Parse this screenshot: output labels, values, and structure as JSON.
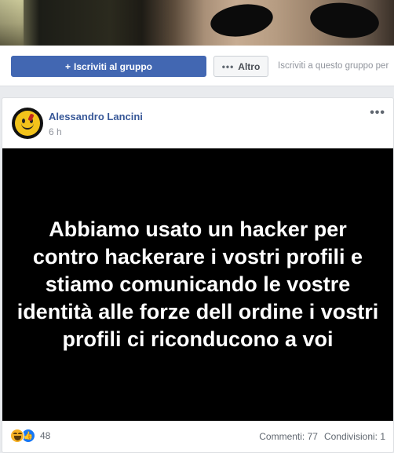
{
  "group_header": {
    "join_button_label": "Iscriviti al gruppo",
    "join_button_icon": "plus-icon",
    "more_button_label": "Altro",
    "more_button_icon": "dots-icon",
    "join_hint": "Iscriviti a questo gruppo per"
  },
  "post": {
    "author": "Alessandro Lancini",
    "timestamp": "6 h",
    "options_icon": "more-options-icon",
    "image_text": "Abbiamo usato un hacker per contro hackerare i vostri profili e stiamo comunicando le vostre identità alle forze dell ordine i vostri profili ci riconducono a voi",
    "reactions": {
      "icons": [
        "haha-icon",
        "like-icon"
      ],
      "count": "48"
    },
    "comments_label": "Commenti: 77",
    "shares_label": "Condivisioni: 1"
  },
  "colors": {
    "brand": "#4267b2",
    "link": "#385898",
    "background": "#e9ebee",
    "image_background": "#000000"
  }
}
